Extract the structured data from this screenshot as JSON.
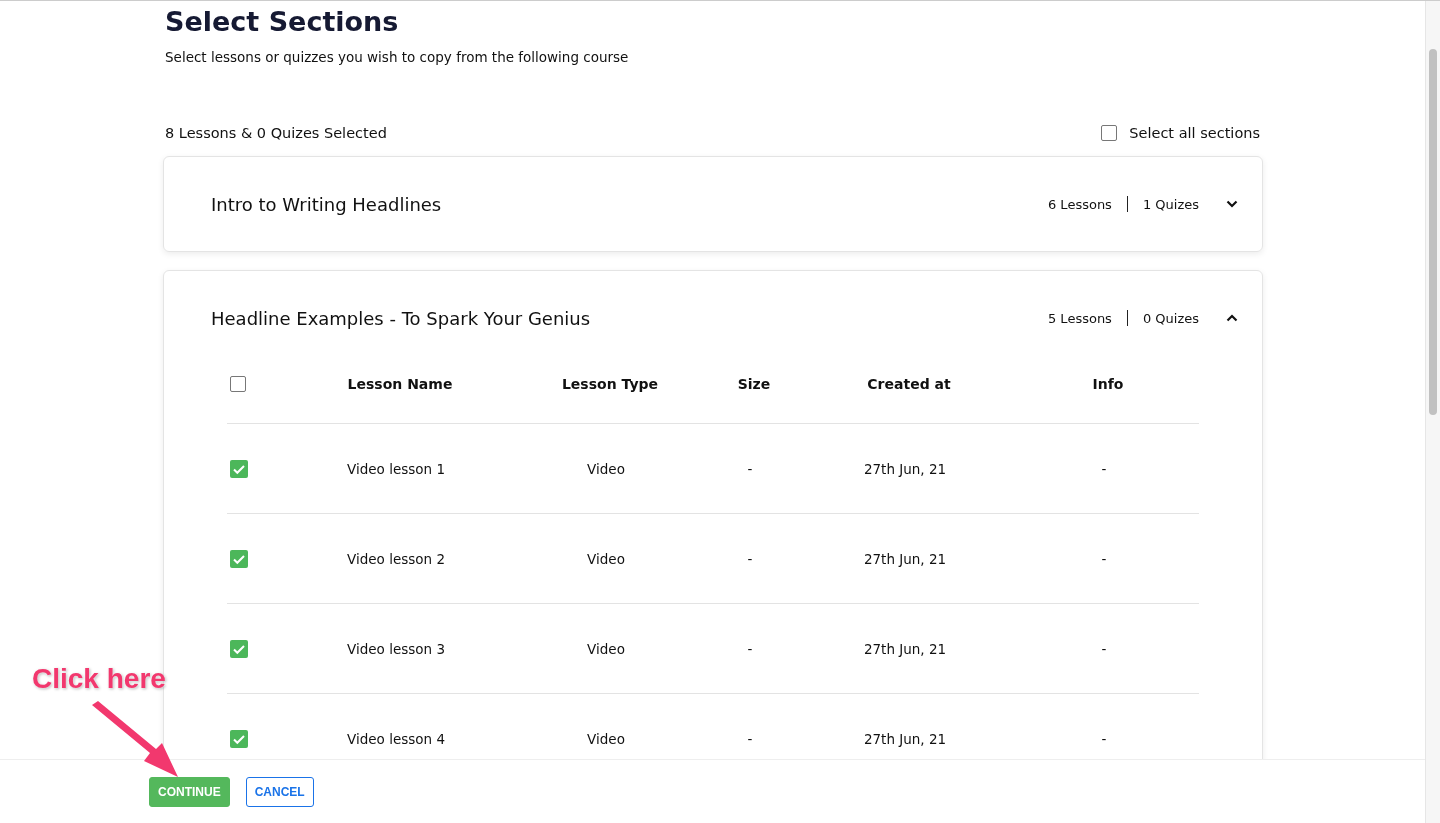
{
  "title": "Select Sections",
  "subtitle": "Select lessons or quizzes you wish to copy from the following course",
  "selection_summary": "8 Lessons & 0 Quizes Selected",
  "select_all": {
    "label": "Select all sections",
    "checked": false
  },
  "sections": [
    {
      "title": "Intro to Writing Headlines",
      "lessons": "6 Lessons",
      "quizzes": "1 Quizes",
      "expanded": false
    },
    {
      "title": "Headline Examples - To Spark Your Genius",
      "lessons": "5 Lessons",
      "quizzes": "0 Quizes",
      "expanded": true,
      "table": {
        "header_checked": false,
        "columns": [
          "Lesson Name",
          "Lesson Type",
          "Size",
          "Created at",
          "Info"
        ],
        "rows": [
          {
            "checked": true,
            "cells": [
              "Video lesson 1",
              "Video",
              "-",
              "27th Jun, 21",
              "-"
            ]
          },
          {
            "checked": true,
            "cells": [
              "Video lesson 2",
              "Video",
              "-",
              "27th Jun, 21",
              "-"
            ]
          },
          {
            "checked": true,
            "cells": [
              "Video lesson 3",
              "Video",
              "-",
              "27th Jun, 21",
              "-"
            ]
          },
          {
            "checked": true,
            "cells": [
              "Video lesson 4",
              "Video",
              "-",
              "27th Jun, 21",
              "-"
            ]
          }
        ]
      }
    }
  ],
  "buttons": [
    {
      "label": "CONTINUE",
      "kind": "primary"
    },
    {
      "label": "CANCEL",
      "kind": "outline"
    }
  ],
  "annotation": "Click here"
}
